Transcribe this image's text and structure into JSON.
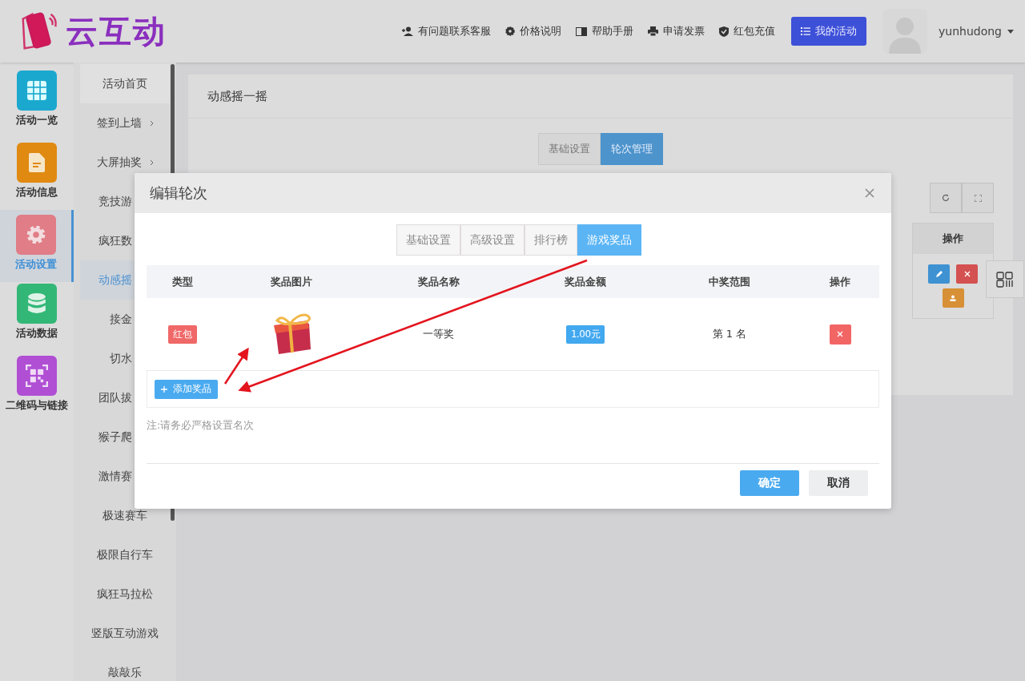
{
  "brand": {
    "name": "云互动"
  },
  "top_nav": [
    {
      "label": "有问题联系客服",
      "kind": "support"
    },
    {
      "label": "价格说明",
      "kind": "pricing"
    },
    {
      "label": "帮助手册",
      "kind": "manual"
    },
    {
      "label": "申请发票",
      "kind": "invoice"
    },
    {
      "label": "红包充值",
      "kind": "recharge"
    }
  ],
  "primary_button": {
    "label": "我的活动"
  },
  "user": {
    "name": "yunhudong"
  },
  "main_menu": [
    {
      "label": "活动一览",
      "selected": false,
      "color": "#1ba8cf",
      "kind": "grid"
    },
    {
      "label": "活动信息",
      "selected": false,
      "color": "#e08a12",
      "kind": "document"
    },
    {
      "label": "活动设置",
      "selected": true,
      "color": "#e07d86",
      "kind": "gear"
    },
    {
      "label": "活动数据",
      "selected": false,
      "color": "#33b777",
      "kind": "database"
    },
    {
      "label": "二维码与链接",
      "selected": false,
      "color": "#b04fd4",
      "kind": "qrcode"
    }
  ],
  "sub_menu": [
    {
      "label": "活动首页",
      "selected": false,
      "expandable": false
    },
    {
      "label": "签到上墙",
      "selected": false,
      "expandable": true
    },
    {
      "label": "大屏抽奖",
      "selected": false,
      "expandable": true
    },
    {
      "label": "竞技游",
      "selected": false,
      "expandable": false
    },
    {
      "label": "疯狂数",
      "selected": false,
      "expandable": false
    },
    {
      "label": "动感摇",
      "selected": true,
      "expandable": false
    },
    {
      "label": "接金",
      "selected": false,
      "expandable": false
    },
    {
      "label": "切水",
      "selected": false,
      "expandable": false
    },
    {
      "label": "团队拔",
      "selected": false,
      "expandable": false
    },
    {
      "label": "猴子爬",
      "selected": false,
      "expandable": false
    },
    {
      "label": "激情赛",
      "selected": false,
      "expandable": false
    },
    {
      "label": "极速赛车",
      "selected": false,
      "expandable": false
    },
    {
      "label": "极限自行车",
      "selected": false,
      "expandable": false
    },
    {
      "label": "疯狂马拉松",
      "selected": false,
      "expandable": false
    },
    {
      "label": "竖版互动游戏",
      "selected": false,
      "expandable": false
    },
    {
      "label": "敲敲乐",
      "selected": false,
      "expandable": false
    }
  ],
  "page": {
    "title": "动感摇一摇",
    "tabs": [
      {
        "label": "基础设置",
        "selected": false
      },
      {
        "label": "轮次管理",
        "selected": true
      }
    ],
    "table": {
      "columns": [
        "操作"
      ]
    }
  },
  "dialog": {
    "title": "编辑轮次",
    "tabs": [
      {
        "label": "基础设置",
        "selected": false
      },
      {
        "label": "高级设置",
        "selected": false
      },
      {
        "label": "排行榜",
        "selected": false
      },
      {
        "label": "游戏奖品",
        "selected": true
      }
    ],
    "columns": [
      "类型",
      "奖品图片",
      "奖品名称",
      "奖品金额",
      "中奖范围",
      "操作"
    ],
    "rows": [
      {
        "type": "红包",
        "name": "一等奖",
        "amount": "1.00元",
        "range": "第 1 名"
      }
    ],
    "add_button": "添加奖品",
    "note": "注:请务必严格设置名次",
    "buttons": [
      {
        "label": "确定",
        "kind": "primary"
      },
      {
        "label": "取消",
        "kind": "default"
      }
    ]
  }
}
